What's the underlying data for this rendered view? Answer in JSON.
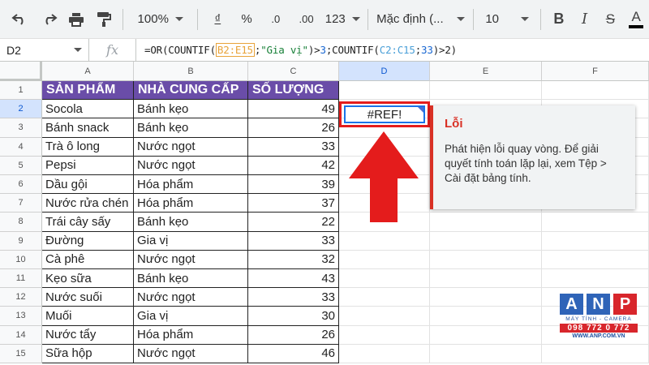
{
  "toolbar": {
    "zoom": "100%",
    "currency": "₫",
    "percent": "%",
    "dec_decrease": ".0",
    "dec_increase": ".00",
    "number_format": "123",
    "font": "Mặc định (...",
    "font_size": "10",
    "bold": "B",
    "text_color": "A"
  },
  "formula_bar": {
    "name_box": "D2",
    "fx": "fx",
    "f_prefix": "=OR(COUNTIF(",
    "f_range1": "B2:E15",
    "f_sep1": ";",
    "f_str": "\"Gia vị\"",
    "f_mid": ")>",
    "f_num1": "3",
    "f_mid2": ";COUNTIF(",
    "f_range2": "C2:C15",
    "f_sep2": ";",
    "f_num2": "33",
    "f_end": ")>2)"
  },
  "columns": [
    "A",
    "B",
    "C",
    "D",
    "E",
    "F"
  ],
  "rows": [
    "1",
    "2",
    "3",
    "4",
    "5",
    "6",
    "7",
    "8",
    "9",
    "10",
    "11",
    "12",
    "13",
    "14",
    "15"
  ],
  "headers": {
    "a": "SẢN PHẨM",
    "b": "NHÀ CUNG CẤP",
    "c": "SỐ LƯỢNG"
  },
  "table": [
    {
      "a": "Socola",
      "b": "Bánh kẹo",
      "c": "49"
    },
    {
      "a": "Bánh snack",
      "b": "Bánh kẹo",
      "c": "26"
    },
    {
      "a": "Trà ô long",
      "b": "Nước ngọt",
      "c": "33"
    },
    {
      "a": "Pepsi",
      "b": "Nước ngọt",
      "c": "42"
    },
    {
      "a": "Dầu gội",
      "b": "Hóa phẩm",
      "c": "39"
    },
    {
      "a": "Nước rửa chén",
      "b": "Hóa phẩm",
      "c": "37"
    },
    {
      "a": "Trái cây sấy",
      "b": "Bánh kẹo",
      "c": "22"
    },
    {
      "a": "Đường",
      "b": "Gia vị",
      "c": "33"
    },
    {
      "a": "Cà phê",
      "b": "Nước ngọt",
      "c": "32"
    },
    {
      "a": "Kẹo sữa",
      "b": "Bánh kẹo",
      "c": "43"
    },
    {
      "a": "Nước suối",
      "b": "Nước ngọt",
      "c": "33"
    },
    {
      "a": "Muối",
      "b": "Gia vị",
      "c": "30"
    },
    {
      "a": "Nước tẩy",
      "b": "Hóa phẩm",
      "c": "26"
    },
    {
      "a": "Sữa hộp",
      "b": "Nước ngọt",
      "c": "46"
    }
  ],
  "error_cell": {
    "value": "#REF!"
  },
  "tooltip": {
    "title": "Lỗi",
    "body": "Phát hiện lỗi quay vòng. Để giải quyết tính toán lặp lại, xem Tệp > Cài đặt bảng tính."
  },
  "logo": {
    "letters": [
      "A",
      "N",
      "P"
    ],
    "tagline": "MÁY TÍNH - CAMERA",
    "phone": "098 772 0 772",
    "website": "WWW.ANP.COM.VN"
  },
  "colors": {
    "header_fill": "#6a4da8",
    "error_red": "#d93025",
    "highlight_red": "#e41c1c",
    "selection_blue": "#1a73e8"
  }
}
